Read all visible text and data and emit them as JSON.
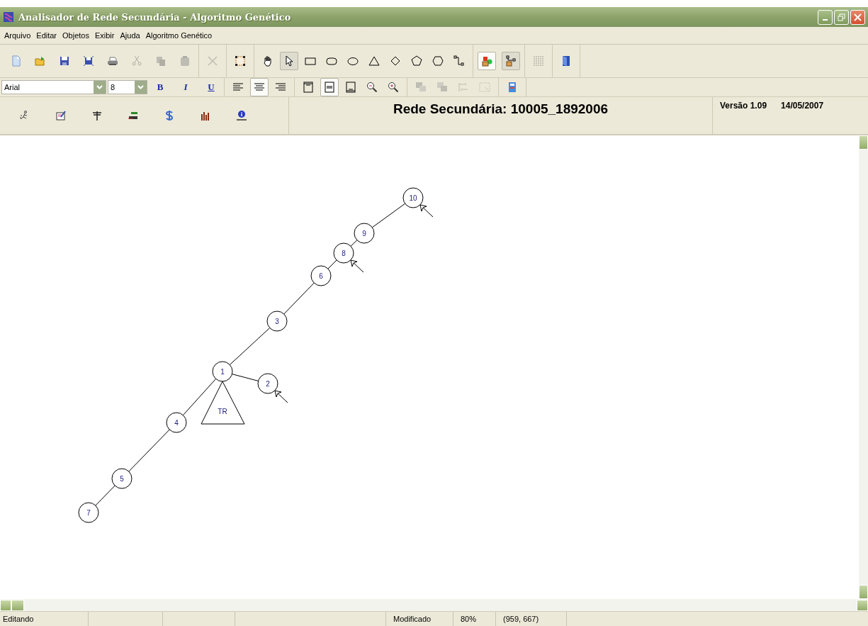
{
  "window": {
    "title": "Analisador de Rede Secundária - Algoritmo Genético"
  },
  "menu": [
    {
      "label": "Arquivo"
    },
    {
      "label": "Editar"
    },
    {
      "label": "Objetos"
    },
    {
      "label": "Exibir"
    },
    {
      "label": "Ajuda"
    },
    {
      "label": "Algoritmo Genético"
    }
  ],
  "toolbar": [
    {
      "buttons": [
        {
          "kind": "new",
          "selected": false,
          "disabled": false
        },
        {
          "kind": "open",
          "selected": false,
          "disabled": false
        },
        {
          "kind": "save",
          "selected": false,
          "disabled": false
        },
        {
          "kind": "saveas",
          "selected": false,
          "disabled": false
        },
        {
          "kind": "print",
          "selected": false,
          "disabled": false
        },
        {
          "kind": "cut",
          "selected": false,
          "disabled": true
        },
        {
          "kind": "copy",
          "selected": false,
          "disabled": true
        },
        {
          "kind": "paste",
          "selected": false,
          "disabled": true
        }
      ]
    },
    {
      "buttons": [
        {
          "kind": "delete",
          "selected": false,
          "disabled": true
        }
      ]
    },
    {
      "buttons": [
        {
          "kind": "selectarea",
          "selected": false,
          "disabled": false
        }
      ]
    },
    {
      "buttons": [
        {
          "kind": "hand",
          "selected": false,
          "disabled": false
        },
        {
          "kind": "pointer",
          "selected": true,
          "disabled": false
        },
        {
          "kind": "rect",
          "selected": false,
          "disabled": false
        },
        {
          "kind": "roundrect",
          "selected": false,
          "disabled": false
        },
        {
          "kind": "ellipse",
          "selected": false,
          "disabled": false
        },
        {
          "kind": "triangle",
          "selected": false,
          "disabled": false
        },
        {
          "kind": "diamond",
          "selected": false,
          "disabled": false
        },
        {
          "kind": "pentagon",
          "selected": false,
          "disabled": false
        },
        {
          "kind": "hexagon",
          "selected": false,
          "disabled": false
        },
        {
          "kind": "connector",
          "selected": false,
          "disabled": false
        }
      ]
    },
    {
      "buttons": [
        {
          "kind": "lockshapes",
          "selected": true,
          "disabled": false
        },
        {
          "kind": "lockconnectors",
          "selected": true,
          "disabled": false
        }
      ]
    },
    {
      "buttons": [
        {
          "kind": "grid",
          "selected": false,
          "disabled": false
        }
      ]
    },
    {
      "buttons": [
        {
          "kind": "exit",
          "selected": false,
          "disabled": false
        }
      ]
    }
  ],
  "format_bar": {
    "font": "Arial",
    "size": "8",
    "styles": [
      {
        "kind": "bold",
        "label": "B"
      },
      {
        "kind": "italic",
        "label": "I"
      },
      {
        "kind": "underline",
        "label": "U"
      }
    ],
    "groups": [
      {
        "buttons": [
          {
            "kind": "alignleft",
            "selected": false,
            "disabled": false
          },
          {
            "kind": "aligncenter",
            "selected": true,
            "disabled": false
          },
          {
            "kind": "alignright",
            "selected": false,
            "disabled": false
          }
        ]
      },
      {
        "buttons": [
          {
            "kind": "valigntop",
            "selected": false,
            "disabled": false
          },
          {
            "kind": "valignmiddle",
            "selected": true,
            "disabled": false
          },
          {
            "kind": "valignbottom",
            "selected": false,
            "disabled": false
          },
          {
            "kind": "zoomout",
            "selected": false,
            "disabled": false
          },
          {
            "kind": "zoomin",
            "selected": false,
            "disabled": false
          }
        ]
      },
      {
        "buttons": [
          {
            "kind": "front",
            "selected": false,
            "disabled": true
          },
          {
            "kind": "back",
            "selected": false,
            "disabled": true
          },
          {
            "kind": "swap",
            "selected": false,
            "disabled": true
          },
          {
            "kind": "group",
            "selected": false,
            "disabled": true
          }
        ]
      },
      {
        "buttons": [
          {
            "kind": "report",
            "selected": false,
            "disabled": false
          }
        ]
      }
    ]
  },
  "tools": [
    {
      "kind": "run"
    },
    {
      "kind": "edit"
    },
    {
      "kind": "pole"
    },
    {
      "kind": "cable"
    },
    {
      "kind": "money"
    },
    {
      "kind": "chart"
    },
    {
      "kind": "info"
    }
  ],
  "network_title": "Rede Secundária: 10005_1892006",
  "version": "Versão 1.09",
  "date": "14/05/2007",
  "diagram": {
    "root": {
      "label": "1",
      "load": false,
      "transformer": "TR",
      "children": [
        {
          "label": "3",
          "load": false,
          "children": [
            {
              "label": "6",
              "load": false,
              "children": [
                {
                  "label": "8",
                  "load": true,
                  "children": [
                    {
                      "label": "9",
                      "load": false,
                      "children": [
                        {
                          "label": "10",
                          "load": true
                        }
                      ]
                    }
                  ]
                }
              ]
            }
          ]
        },
        {
          "label": "2",
          "load": true
        },
        {
          "label": "4",
          "load": false,
          "children": [
            {
              "label": "5",
              "load": false,
              "children": [
                {
                  "label": "7",
                  "load": false
                }
              ]
            }
          ]
        }
      ]
    }
  },
  "status_bar": {
    "mode": "Editando",
    "state": "Modificado",
    "zoom": "80%",
    "position": "(959, 667)"
  }
}
